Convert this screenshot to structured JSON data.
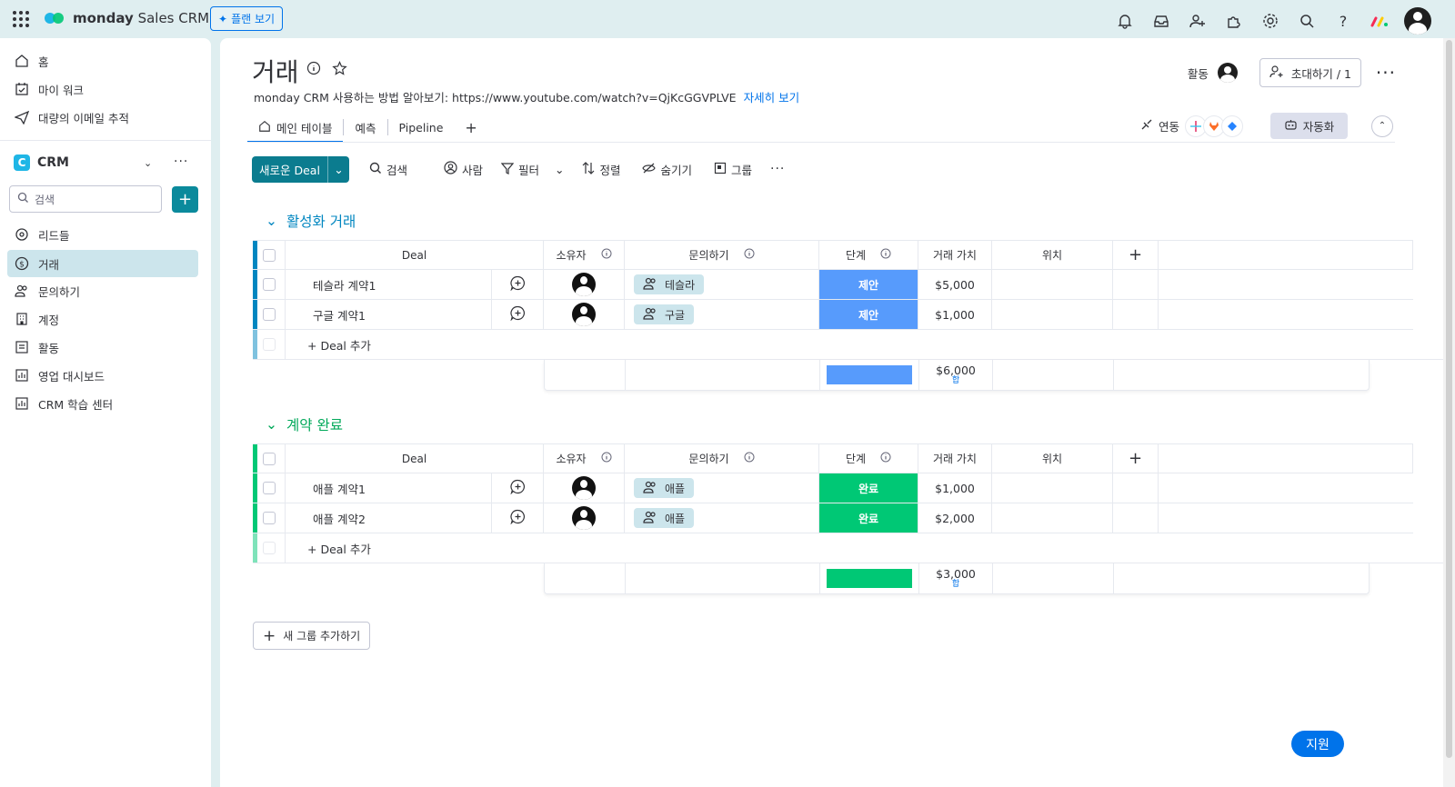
{
  "topbar": {
    "brand_bold": "monday",
    "brand_rest": " Sales CRM",
    "plan_button": "플랜 보기",
    "icons": [
      "bell-icon",
      "inbox-icon",
      "invite-user-icon",
      "apps-icon",
      "gear-icon",
      "search-icon",
      "help-icon",
      "monday-logo",
      "user-avatar"
    ]
  },
  "sidebar": {
    "nav": [
      {
        "label": "홈",
        "icon": "home-icon"
      },
      {
        "label": "마이 워크",
        "icon": "calendar-check-icon"
      },
      {
        "label": "대량의 이메일 추적",
        "icon": "send-icon"
      }
    ],
    "workspace": {
      "badge": "C",
      "name": "CRM"
    },
    "search_placeholder": "검색",
    "items": [
      {
        "label": "리드들",
        "icon": "target-icon",
        "active": false
      },
      {
        "label": "거래",
        "icon": "dollar-icon",
        "active": true
      },
      {
        "label": "문의하기",
        "icon": "contacts-icon",
        "active": false
      },
      {
        "label": "계정",
        "icon": "building-icon",
        "active": false
      },
      {
        "label": "활동",
        "icon": "list-icon",
        "active": false
      },
      {
        "label": "영업 대시보드",
        "icon": "dashboard-icon",
        "active": false
      },
      {
        "label": "CRM 학습 센터",
        "icon": "dashboard-icon",
        "active": false
      }
    ]
  },
  "board": {
    "title": "거래",
    "description": "monday CRM 사용하는 방법 알아보기: https://www.youtube.com/watch?v=QjKcGGVPLVE",
    "see_more": "자세히 보기",
    "activity_label": "활동",
    "invite_label": "초대하기 / 1",
    "tabs": [
      "메인 테이블",
      "예측",
      "Pipeline",
      "+"
    ],
    "integrate_label": "연동",
    "automate_label": "자동화"
  },
  "toolbar": {
    "new_item": "새로운 Deal",
    "search": "검색",
    "person": "사람",
    "filter": "필터",
    "sort": "정렬",
    "hide": "숨기기",
    "group": "그룹"
  },
  "columns": {
    "deal": "Deal",
    "owner": "소유자",
    "contact": "문의하기",
    "stage": "단계",
    "value": "거래 가치",
    "location": "위치"
  },
  "groups": [
    {
      "title": "활성화 거래",
      "color": "#0086c0",
      "stripe": "#0086c0",
      "rows": [
        {
          "deal": "테슬라 계약1",
          "contact": "테슬라",
          "stage": "제안",
          "stage_color": "#579bfc",
          "value": "$5,000"
        },
        {
          "deal": "구글 계약1",
          "contact": "구글",
          "stage": "제안",
          "stage_color": "#579bfc",
          "value": "$1,000"
        }
      ],
      "add_label": "+ Deal 추가",
      "sum_value": "$6,000",
      "sum_label": "합",
      "sum_color": "#579bfc"
    },
    {
      "title": "계약 완료",
      "color": "#00a859",
      "stripe": "#00c875",
      "rows": [
        {
          "deal": "애플 계약1",
          "contact": "애플",
          "stage": "완료",
          "stage_color": "#00c875",
          "value": "$1,000"
        },
        {
          "deal": "애플 계약2",
          "contact": "애플",
          "stage": "완료",
          "stage_color": "#00c875",
          "value": "$2,000"
        }
      ],
      "add_label": "+ Deal 추가",
      "sum_value": "$3,000",
      "sum_label": "합",
      "sum_color": "#00c875"
    }
  ],
  "add_group_label": "새 그룹 추가하기",
  "help_label": "지원"
}
